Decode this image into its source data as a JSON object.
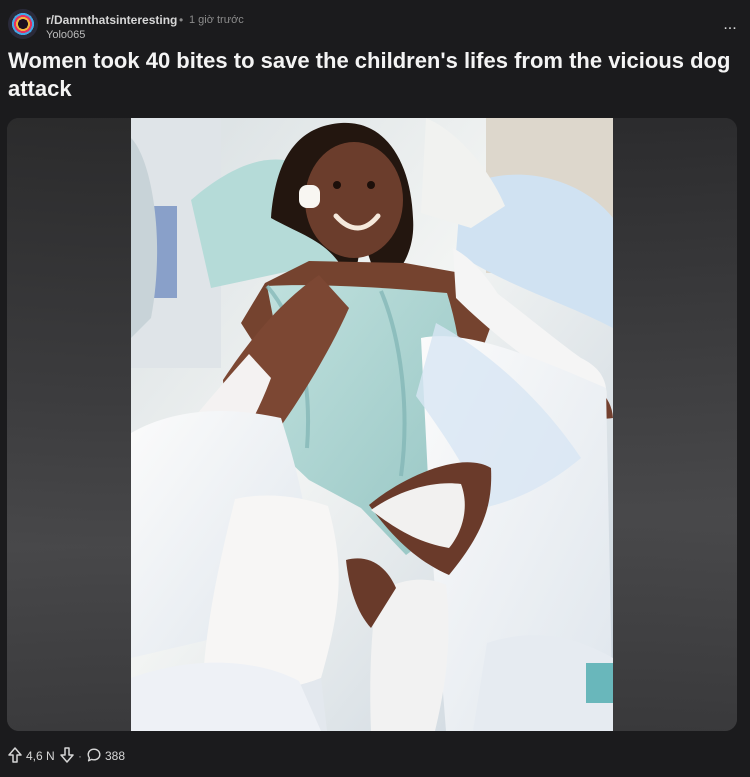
{
  "post": {
    "subreddit": "r/Damnthatsinteresting",
    "separator": "•",
    "time": "1 giờ trước",
    "author": "Yolo065",
    "more_label": "...",
    "title": "Women took 40 bites to save the children's lifes from the vicious dog attack",
    "votes": "4,6 N",
    "action_separator": "·",
    "comments": "388"
  },
  "colors": {
    "background": "#1b1b1d",
    "text": "#f2f2f2",
    "muted": "#8b8b8b"
  },
  "icons": {
    "upvote": "upvote-icon",
    "downvote": "downvote-icon",
    "comment": "comment-icon",
    "more": "more-icon"
  }
}
